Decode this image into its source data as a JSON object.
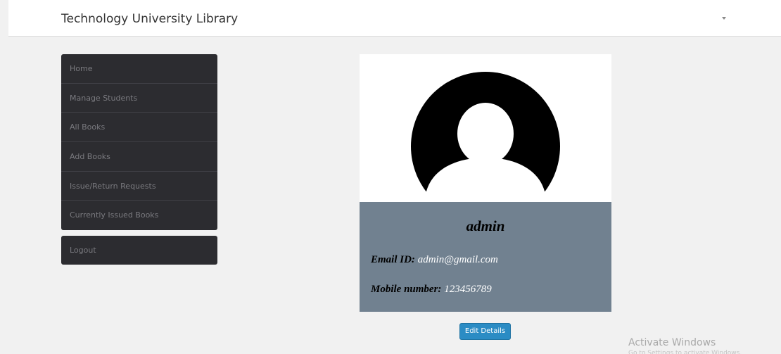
{
  "navbar": {
    "brand": "Technology University Library",
    "dropdown_icon": "caret-down-icon"
  },
  "sidebar": {
    "items": [
      {
        "label": "Home"
      },
      {
        "label": "Manage Students"
      },
      {
        "label": "All Books"
      },
      {
        "label": "Add Books"
      },
      {
        "label": "Issue/Return Requests"
      },
      {
        "label": "Currently Issued Books"
      }
    ],
    "logout_label": "Logout"
  },
  "profile": {
    "avatar_icon": "user-avatar-icon",
    "name": "admin",
    "email_label": "Email ID:",
    "email": "admin@gmail.com",
    "mobile_label": "Mobile number:",
    "mobile": "123456789"
  },
  "actions": {
    "edit_label": "Edit Details"
  },
  "os_watermark": {
    "title": "Activate Windows",
    "subtitle": "Go to Settings to activate Windows."
  },
  "colors": {
    "sidebar_bg": "#2c2c30",
    "info_bg": "#718190",
    "button_bg": "#2b8cc4"
  }
}
